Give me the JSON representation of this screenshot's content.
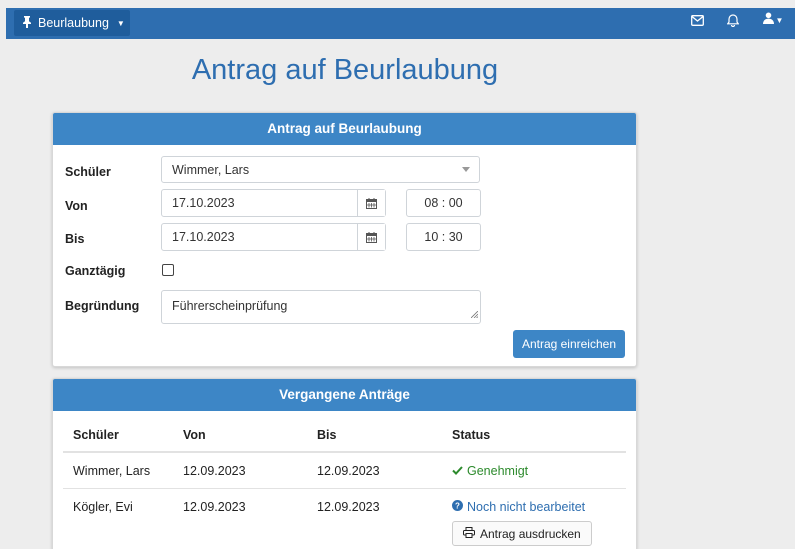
{
  "navbar": {
    "dropdown_label": "Beurlaubung",
    "icons": [
      "pin-icon",
      "mail-icon",
      "bell-icon",
      "user-icon"
    ],
    "accent": "#2e6eb0"
  },
  "page": {
    "title": "Antrag auf Beurlaubung"
  },
  "form": {
    "header": "Antrag auf Beurlaubung",
    "student_label": "Schüler",
    "student_value": "Wimmer, Lars",
    "from_label": "Von",
    "from_date": "17.10.2023",
    "from_time": "08 : 00",
    "to_label": "Bis",
    "to_date": "17.10.2023",
    "to_time": "10 : 30",
    "allday_label": "Ganztägig",
    "allday_checked": false,
    "reason_label": "Begründung",
    "reason_value": "Führerscheinprüfung",
    "submit_label": "Antrag einreichen"
  },
  "history": {
    "header": "Vergangene Anträge",
    "columns": [
      "Schüler",
      "Von",
      "Bis",
      "Status"
    ],
    "rows": [
      {
        "student": "Wimmer, Lars",
        "from": "12.09.2023",
        "to": "12.09.2023",
        "status": "Genehmigt",
        "status_color": "#2c8a2c"
      },
      {
        "student": "Kögler, Evi",
        "from": "12.09.2023",
        "to": "12.09.2023",
        "status": "Noch nicht bearbeitet",
        "status_color": "#2e6eb0",
        "action": "Antrag ausdrucken"
      }
    ]
  }
}
